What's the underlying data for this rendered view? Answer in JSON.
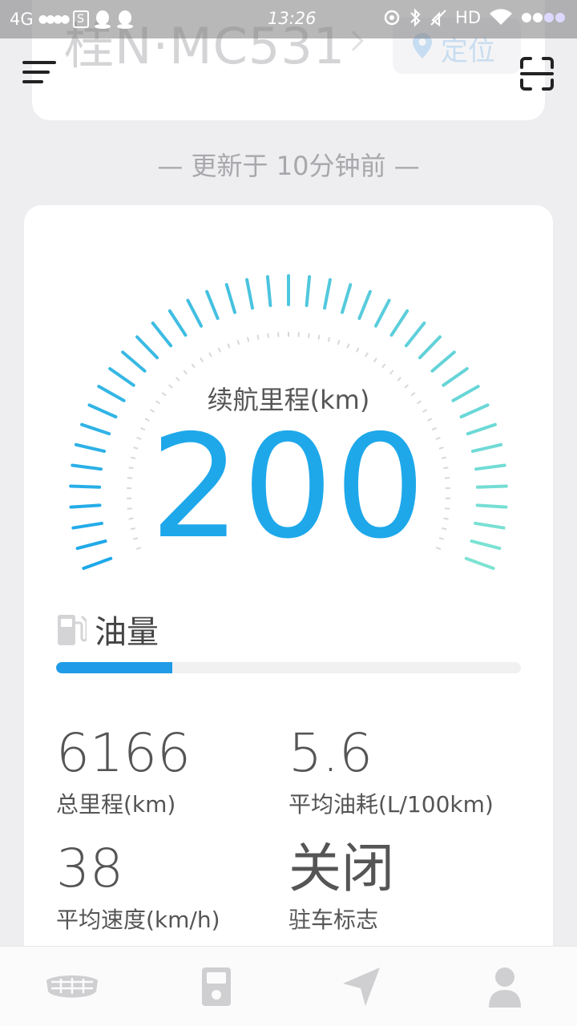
{
  "status_bar": {
    "network": "4G",
    "time": "13:26",
    "hd_label": "HD"
  },
  "header": {
    "plate": "桂N·MC531",
    "locate_label": "定位"
  },
  "updated_text": "— 更新于 10分钟前 —",
  "gauge": {
    "label": "续航里程(km)",
    "value": "200",
    "accent_start": "#1ea8ea",
    "accent_end": "#7de3d2"
  },
  "fuel": {
    "label": "油量",
    "level_fraction": 0.25,
    "bar_color": "#1f9be8"
  },
  "stats": [
    {
      "value": "6166",
      "label": "总里程(km)"
    },
    {
      "value": "5.6",
      "label": "平均油耗(L/100km)"
    },
    {
      "value": "38",
      "label": "平均速度(km/h)"
    },
    {
      "value": "关闭",
      "label": "驻车标志"
    }
  ],
  "nav": [
    {
      "icon": "car-brand-icon"
    },
    {
      "icon": "remote-key-icon"
    },
    {
      "icon": "navigation-arrow-icon"
    },
    {
      "icon": "user-profile-icon"
    }
  ]
}
